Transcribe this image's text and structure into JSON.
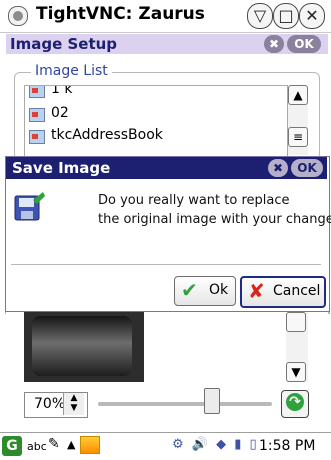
{
  "window": {
    "title": "TightVNC: Zaurus",
    "buttons": {
      "menu": "▽",
      "restore": "□",
      "close": "✕"
    }
  },
  "image_setup": {
    "title": "Image Setup",
    "close_label": "✖",
    "ok_label": "OK"
  },
  "image_list": {
    "label": "Image List",
    "items": [
      {
        "label": "1 k",
        "icon": "image-document-icon"
      },
      {
        "label": "02",
        "icon": "image-document-icon"
      },
      {
        "label": "tkcAddressBook",
        "icon": "image-document-icon"
      }
    ],
    "scroll_up": "▲",
    "scroll_thumb": "≡"
  },
  "dialog": {
    "title": "Save Image",
    "close_label": "✖",
    "ok_label": "OK",
    "message_line1": "Do you really want to replace",
    "message_line2": "the original image with your change:",
    "buttons": {
      "ok": {
        "label": "Ok",
        "mark": "✔"
      },
      "cancel": {
        "label": "Cancel",
        "mark": "✘"
      }
    }
  },
  "lower": {
    "scroll_down": "▼",
    "zoom_value": "70%",
    "spin_up": "▲",
    "spin_down": "▼",
    "slider_value_percent": 70,
    "go_icon": "↷"
  },
  "taskbar": {
    "start_icon": "G",
    "input_mode": "abc",
    "pen_icon": "✎",
    "up_arrow": "▲",
    "tray_icons": "⚙ 🔊 ◆ ▮ ▯",
    "time": "1:58 PM"
  },
  "colors": {
    "dialog_title_bg": "#1d1f71",
    "setup_bar_bg": "#dcd2ef",
    "accent_green": "#2ea23c"
  }
}
